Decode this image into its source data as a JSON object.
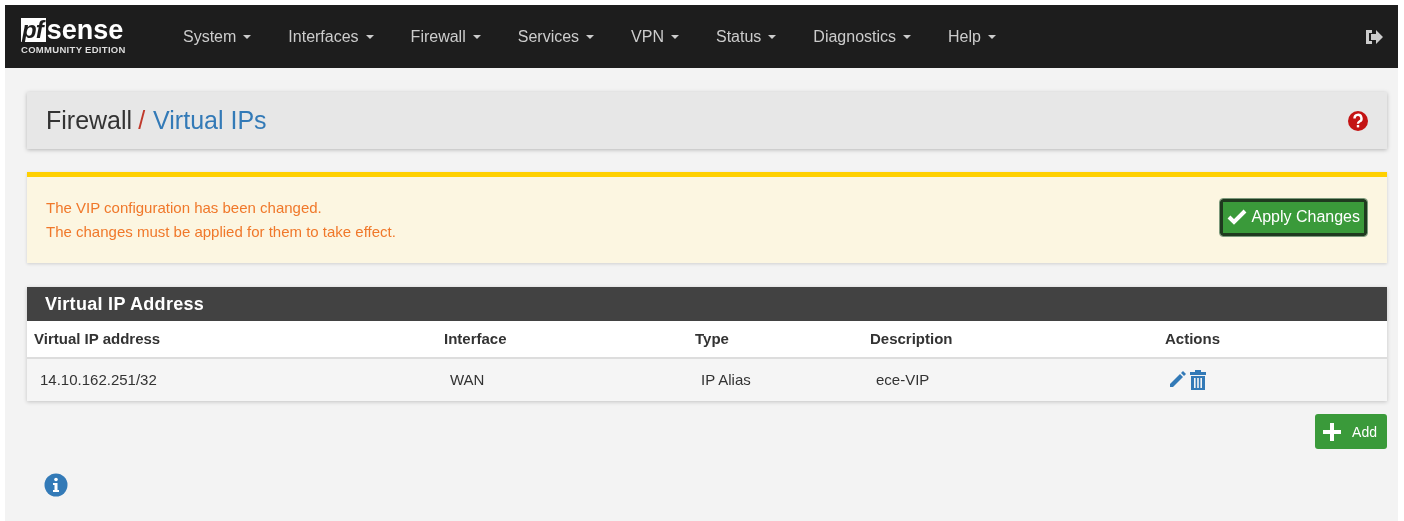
{
  "navbar": {
    "logo": {
      "mark": "pf",
      "word": "sense",
      "edition": "COMMUNITY EDITION"
    },
    "menus": [
      {
        "label": "System"
      },
      {
        "label": "Interfaces"
      },
      {
        "label": "Firewall"
      },
      {
        "label": "Services"
      },
      {
        "label": "VPN"
      },
      {
        "label": "Status"
      },
      {
        "label": "Diagnostics"
      },
      {
        "label": "Help"
      }
    ]
  },
  "breadcrumb": {
    "section": "Firewall",
    "separator": "/",
    "page": "Virtual IPs"
  },
  "alert": {
    "lines": [
      "The VIP configuration has been changed.",
      "The changes must be applied for them to take effect."
    ],
    "button": "Apply Changes"
  },
  "table": {
    "title": "Virtual IP Address",
    "columns": [
      "Virtual IP address",
      "Interface",
      "Type",
      "Description",
      "Actions"
    ],
    "rows": [
      {
        "cells": [
          "14.10.162.251/32",
          "WAN",
          "IP Alias",
          "ece-VIP"
        ]
      }
    ]
  },
  "add_button": "Add"
}
